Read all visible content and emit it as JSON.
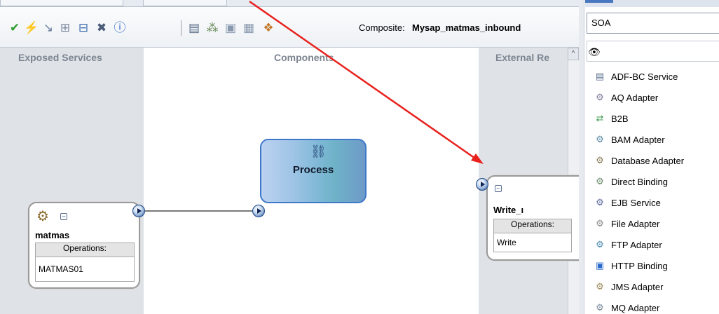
{
  "toolbar": {
    "composite_label": "Composite:",
    "composite_name": "Mysap_matmas_inbound",
    "buttons": [
      {
        "icon": "checkmark-icon",
        "glyph": "✔",
        "color": "#2f9d2f"
      },
      {
        "icon": "lightning-icon",
        "glyph": "⚡",
        "color": "#d63a1c"
      },
      {
        "icon": "wire-icon",
        "glyph": "↘",
        "color": "#6a7f9c"
      },
      {
        "icon": "add-service-icon",
        "glyph": "⊞",
        "color": "#7e8aa0"
      },
      {
        "icon": "add-reference-icon",
        "glyph": "⊟",
        "color": "#3f6eae"
      },
      {
        "icon": "delete-icon",
        "glyph": "✖",
        "color": "#4a5c78"
      },
      {
        "icon": "info-icon",
        "glyph": "ⓘ",
        "color": "#2d62c9"
      },
      {
        "icon": "deploy-icon",
        "glyph": "▤",
        "color": "#586a84"
      },
      {
        "icon": "layout-icon",
        "glyph": "⁂",
        "color": "#6c8c5c"
      },
      {
        "icon": "test-icon",
        "glyph": "▣",
        "color": "#8898ae"
      },
      {
        "icon": "document-icon",
        "glyph": "▦",
        "color": "#8898ae"
      },
      {
        "icon": "paint-icon",
        "glyph": "❖",
        "color": "#c47a2a"
      }
    ]
  },
  "lanes": {
    "exposed": "Exposed Services",
    "components": "Components",
    "external": "External Re"
  },
  "service": {
    "name": "matmas",
    "ops_header": "Operations:",
    "operation": "MATMAS01"
  },
  "component": {
    "name": "Process"
  },
  "reference": {
    "name": "Write_ı",
    "ops_header": "Operations:",
    "operation": "Write"
  },
  "palette": {
    "category": "SOA",
    "search_value": "",
    "items": [
      {
        "label": "ADF-BC Service",
        "icon": "adf-bc-icon",
        "glyph": "▤",
        "color": "#5c7090"
      },
      {
        "label": "AQ Adapter",
        "icon": "aq-adapter-icon",
        "glyph": "⚙",
        "color": "#7a7a9a"
      },
      {
        "label": "B2B",
        "icon": "b2b-icon",
        "glyph": "⇄",
        "color": "#3c9a4a"
      },
      {
        "label": "BAM Adapter",
        "icon": "bam-adapter-icon",
        "glyph": "⚙",
        "color": "#5a8aa8"
      },
      {
        "label": "Database Adapter",
        "icon": "database-adapter-icon",
        "glyph": "⚙",
        "color": "#8a7a5a"
      },
      {
        "label": "Direct Binding",
        "icon": "direct-binding-icon",
        "glyph": "⚙",
        "color": "#6a8a6a"
      },
      {
        "label": "EJB Service",
        "icon": "ejb-service-icon",
        "glyph": "⚙",
        "color": "#5a6a9a"
      },
      {
        "label": "File Adapter",
        "icon": "file-adapter-icon",
        "glyph": "⚙",
        "color": "#8a8a8a"
      },
      {
        "label": "FTP Adapter",
        "icon": "ftp-adapter-icon",
        "glyph": "⚙",
        "color": "#4a8ab0"
      },
      {
        "label": "HTTP Binding",
        "icon": "http-binding-icon",
        "glyph": "▣",
        "color": "#2a6ac8"
      },
      {
        "label": "JMS Adapter",
        "icon": "jms-adapter-icon",
        "glyph": "⚙",
        "color": "#9a8a5a"
      },
      {
        "label": "MQ Adapter",
        "icon": "mq-adapter-icon",
        "glyph": "⚙",
        "color": "#7a8a9a"
      }
    ]
  },
  "colors": {
    "arrow": "#e8211d",
    "lane_gray": "#dfe3e8",
    "bpel_border": "#3f78c9"
  }
}
